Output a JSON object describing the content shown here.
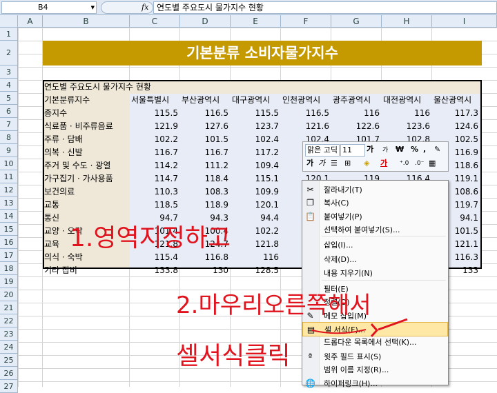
{
  "name_box": "B4",
  "fx_label": "fx",
  "formula": "연도별 주요도시 물가지수 현황",
  "columns": [
    "A",
    "B",
    "C",
    "D",
    "E",
    "F",
    "G",
    "H",
    "I"
  ],
  "rows": [
    "1",
    "2",
    "3",
    "4",
    "5",
    "6",
    "7",
    "8",
    "9",
    "10",
    "11",
    "12",
    "13",
    "14",
    "15",
    "16",
    "17",
    "18",
    "19",
    "20",
    "21",
    "22",
    "23",
    "24",
    "25",
    "26",
    "27"
  ],
  "banner": "기본분류 소비자물가지수",
  "table_title": "연도별 주요도시 물가지수 현황",
  "headers": [
    "기본분류지수",
    "서울특별시",
    "부산광역시",
    "대구광역시",
    "인천광역시",
    "광주광역시",
    "대전광역시",
    "울산광역시"
  ],
  "table": [
    [
      "종지수",
      "115.5",
      "116.5",
      "115.5",
      "116.5",
      "116",
      "116",
      "117.3"
    ],
    [
      "식료품 · 비주류음료",
      "121.9",
      "127.6",
      "123.7",
      "121.6",
      "122.6",
      "123.6",
      "124.6"
    ],
    [
      "주류 · 담배",
      "102.2",
      "101.5",
      "102.4",
      "102.4",
      "101.7",
      "102.8",
      "102.5"
    ],
    [
      "의복 · 신발",
      "116.7",
      "116.7",
      "117.2",
      "",
      "",
      "",
      "116.9"
    ],
    [
      "주거 및 수도 · 광열",
      "114.2",
      "111.2",
      "109.4",
      "",
      "",
      "",
      "118.6"
    ],
    [
      "가구집기 · 가사용품",
      "114.7",
      "118.4",
      "115.1",
      "120.1",
      "119",
      "116.4",
      "119.1"
    ],
    [
      "보건의료",
      "110.3",
      "108.3",
      "109.9",
      "",
      "",
      "",
      "108.6"
    ],
    [
      "교통",
      "118.5",
      "118.9",
      "120.1",
      "",
      "",
      "",
      "119.7"
    ],
    [
      "통신",
      "94.7",
      "94.3",
      "94.4",
      "",
      "",
      "",
      "94.1"
    ],
    [
      "교양 · 오락",
      "101.4",
      "100.4",
      "102.2",
      "",
      "",
      "",
      "101.5"
    ],
    [
      "교육",
      "121.8",
      "124.7",
      "121.8",
      "",
      "",
      "",
      "121.1"
    ],
    [
      "의식 · 숙박",
      "115.4",
      "116.8",
      "116",
      "",
      "",
      "",
      "116.3"
    ],
    [
      "기타 잡비",
      "133.8",
      "130",
      "128.5",
      "",
      "",
      "",
      "133"
    ]
  ],
  "mini_toolbar": {
    "font": "맑은 고딕",
    "size": "11",
    "grow": "가",
    "shrink": "가",
    "currency": "₩",
    "percent": "%",
    "comma": ",",
    "bold": "가",
    "italic": "가",
    "font_color": "가"
  },
  "context_menu": {
    "items": [
      {
        "label": "잘라내기(T)",
        "icon": "scissors-icon"
      },
      {
        "label": "복사(C)",
        "icon": "copy-icon"
      },
      {
        "label": "붙여넣기(P)",
        "icon": "paste-icon"
      },
      {
        "label": "선택하여 붙여넣기(S)...",
        "icon": ""
      },
      {
        "label": "삽입(I)...",
        "icon": ""
      },
      {
        "label": "삭제(D)...",
        "icon": ""
      },
      {
        "label": "내용 지우기(N)",
        "icon": ""
      },
      {
        "label": "필터(E)",
        "icon": ""
      },
      {
        "label": "정렬(O)",
        "icon": ""
      },
      {
        "label": "메모 삽입(M)",
        "icon": "comment-icon"
      },
      {
        "label": "셀 서식(F)...",
        "icon": "format-cells-icon"
      },
      {
        "label": "드롭다운 목록에서 선택(K)...",
        "icon": ""
      },
      {
        "label": "윗주 필드 표시(S)",
        "icon": "phonetic-icon"
      },
      {
        "label": "범위 이름 지정(R)...",
        "icon": ""
      },
      {
        "label": "하이퍼링크(H)...",
        "icon": "hyperlink-icon"
      }
    ]
  },
  "annotations": {
    "step1": "1.영역지정하고",
    "step2": "2.마우리오른쪽해서",
    "step3": "셀서식클릭"
  },
  "colors": {
    "banner": "#c49a00",
    "annotation": "#e0141e",
    "highlight": "#ffe8a5"
  }
}
